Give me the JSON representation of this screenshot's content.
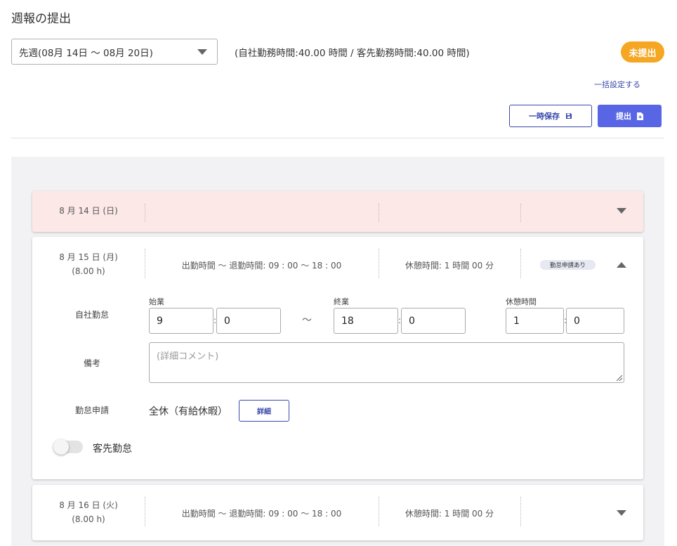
{
  "page": {
    "title": "週報の提出"
  },
  "week_select": {
    "value": "先週(08月 14日 〜 08月 20日)"
  },
  "hours_summary": "(自社勤務時間:40.00 時間 / 客先勤務時間:40.00 時間)",
  "status_badge": {
    "label": "未提出",
    "color": "#f5a623"
  },
  "bulk_setting_link": "一括設定する",
  "toolbar": {
    "save_label": "一時保存",
    "save_icon": "floppy-disk-icon",
    "submit_label": "提出",
    "submit_icon": "document-add-icon",
    "accent_color": "#5866e6"
  },
  "days": [
    {
      "date": "8 月 14 日 (日)",
      "holiday": true,
      "expanded": false
    },
    {
      "date": "8 月 15 日 (月)",
      "hours": "(8.00 h)",
      "work_time": "出勤時間 〜 退勤時間: 09 : 00 〜 18 : 00",
      "break_time": "休憩時間: 1 時間 00 分",
      "request_badge": "勤怠申請あり",
      "expanded": true,
      "detail": {
        "own_attendance_label": "自社勤怠",
        "start_label": "始業",
        "end_label": "終業",
        "break_label": "休憩時間",
        "start_hour": "9",
        "start_minute": "0",
        "end_hour": "18",
        "end_minute": "0",
        "break_hour": "1",
        "break_minute": "0",
        "tilde": "〜",
        "colon": ":",
        "remarks_label": "備考",
        "remarks_placeholder": "(詳細コメント)",
        "leave_request_label": "勤怠申請",
        "leave_request_value": "全休（有給休暇）",
        "detail_button": "詳細",
        "client_attendance_label": "客先勤怠",
        "client_attendance_on": false
      }
    },
    {
      "date": "8 月 16 日 (火)",
      "hours": "(8.00 h)",
      "work_time": "出勤時間 〜 退勤時間: 09 : 00 〜 18 : 00",
      "break_time": "休憩時間: 1 時間 00 分",
      "expanded": false
    }
  ]
}
